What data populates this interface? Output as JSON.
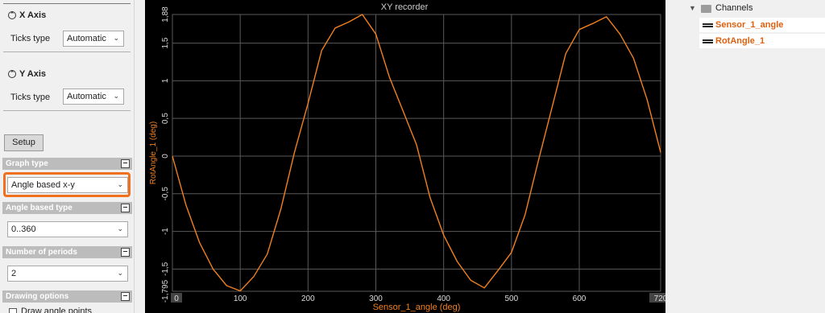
{
  "left": {
    "x_axis": {
      "title": "X Axis",
      "ticks_label": "Ticks type",
      "ticks_value": "Automatic"
    },
    "y_axis": {
      "title": "Y Axis",
      "ticks_label": "Ticks type",
      "ticks_value": "Automatic"
    },
    "setup_label": "Setup",
    "graph_type": {
      "title": "Graph type",
      "value": "Angle based x-y"
    },
    "angle_based_type": {
      "title": "Angle based type",
      "value": "0..360"
    },
    "number_of_periods": {
      "title": "Number of periods",
      "value": "2"
    },
    "drawing_options": {
      "title": "Drawing options",
      "first_option": "Draw angle points"
    }
  },
  "channels": {
    "root_label": "Channels",
    "items": [
      "Sensor_1_angle",
      "RotAngle_1"
    ]
  },
  "chart_data": {
    "type": "line",
    "title": "XY recorder",
    "xlabel": "Sensor_1_angle (deg)",
    "ylabel": "RotAngle_1 (deg)",
    "xlim": [
      0,
      720
    ],
    "ylim": [
      -1.795,
      1.88
    ],
    "x_ticks": [
      "0",
      "100",
      "200",
      "300",
      "400",
      "500",
      "600",
      "720"
    ],
    "y_ticks": [
      "-1,795",
      "-1,5",
      "-1",
      "-0,5",
      "0",
      "0,5",
      "1",
      "1,5",
      "1,88"
    ],
    "series": [
      {
        "name": "RotAngle_1",
        "color": "#f08020",
        "x": [
          0,
          20,
          40,
          60,
          80,
          100,
          120,
          140,
          160,
          180,
          200,
          220,
          240,
          260,
          280,
          300,
          320,
          340,
          360,
          380,
          400,
          420,
          440,
          460,
          480,
          500,
          520,
          540,
          560,
          580,
          600,
          620,
          640,
          660,
          680,
          700,
          720
        ],
        "y": [
          0,
          -0.65,
          -1.15,
          -1.5,
          -1.72,
          -1.79,
          -1.6,
          -1.3,
          -0.7,
          0.05,
          0.7,
          1.4,
          1.7,
          1.78,
          1.88,
          1.62,
          1.05,
          0.6,
          0.15,
          -0.55,
          -1.05,
          -1.4,
          -1.65,
          -1.75,
          -1.52,
          -1.28,
          -0.78,
          -0.05,
          0.65,
          1.36,
          1.68,
          1.76,
          1.85,
          1.62,
          1.3,
          0.75,
          0.05
        ]
      }
    ]
  }
}
